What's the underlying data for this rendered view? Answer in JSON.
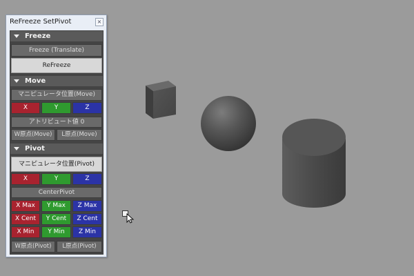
{
  "window": {
    "title": "ReFreeze SetPivot",
    "close_icon": "×"
  },
  "sections": {
    "freeze": {
      "label": "Freeze",
      "freeze_translate": "Freeze (Translate)",
      "refreeze": "ReFreeze"
    },
    "move": {
      "label": "Move",
      "manipulator": "マニピュレータ位置(Move)",
      "x": "X",
      "y": "Y",
      "z": "Z",
      "attribute_value": "アトリビュート値 0",
      "w_origin": "W原点(Move)",
      "l_origin": "L原点(Move)"
    },
    "pivot": {
      "label": "Pivot",
      "manipulator": "マニピュレータ位置(Pivot)",
      "x": "X",
      "y": "Y",
      "z": "Z",
      "center_pivot": "CenterPivot",
      "x_max": "X Max",
      "y_max": "Y Max",
      "z_max": "Z Max",
      "x_cent": "X Cent",
      "y_cent": "Y Cent",
      "z_cent": "Z Cent",
      "x_min": "X Min",
      "y_min": "Y Min",
      "z_min": "Z Min",
      "w_origin": "W原点(Pivot)",
      "l_origin": "L原点(Pivot)"
    }
  },
  "colors": {
    "viewport_bg": "#9b9b9b",
    "x_axis": "#a8232f",
    "y_axis": "#2f9a2f",
    "z_axis": "#2b33a6"
  },
  "scene": {
    "objects": [
      "cube",
      "sphere",
      "cylinder"
    ],
    "cursor_icon": "arrow-cursor-icon"
  }
}
